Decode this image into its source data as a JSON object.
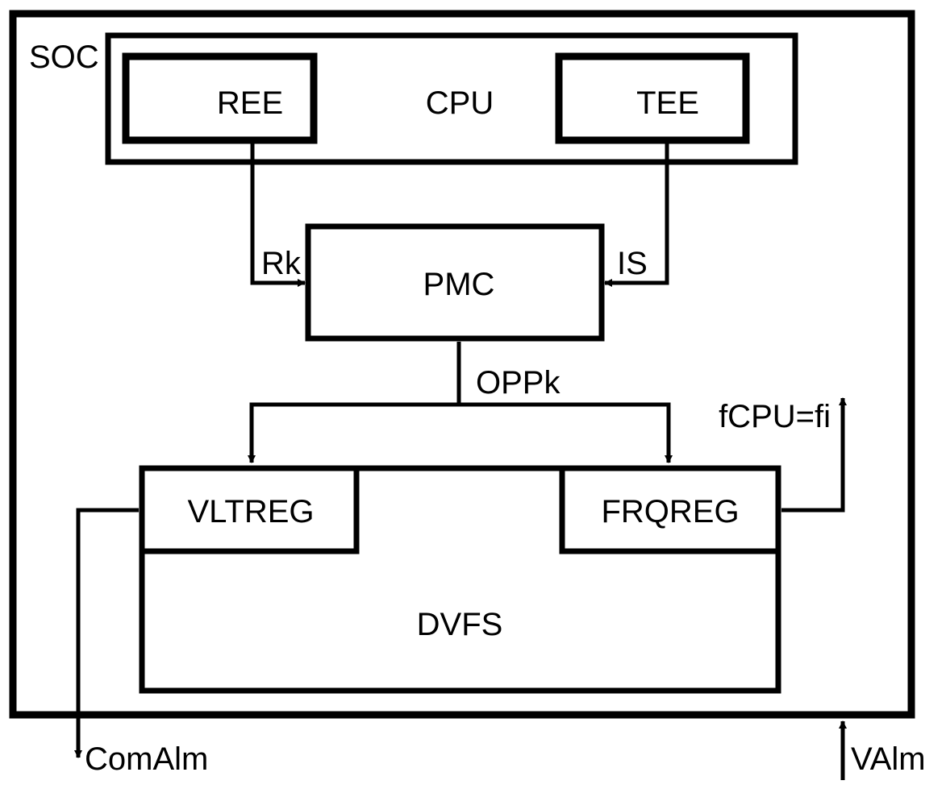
{
  "diagram": {
    "type": "block-diagram",
    "colors": {
      "stroke": "#000000",
      "background": "#ffffff"
    },
    "blocks": {
      "soc": {
        "label": "SOC"
      },
      "cpu": {
        "label": "CPU"
      },
      "ree": {
        "label": "REE"
      },
      "tee": {
        "label": "TEE"
      },
      "pmc": {
        "label": "PMC"
      },
      "dvfs": {
        "label": "DVFS"
      },
      "vltreg": {
        "label": "VLTREG"
      },
      "frqreg": {
        "label": "FRQREG"
      }
    },
    "signals": {
      "rk": {
        "label": "Rk",
        "from": "REE",
        "to": "PMC"
      },
      "is": {
        "label": "IS",
        "from": "TEE",
        "to": "PMC"
      },
      "oppk": {
        "label": "OPPk",
        "from": "PMC",
        "to": [
          "VLTREG",
          "FRQREG"
        ]
      },
      "fcpu": {
        "label": "fCPU=fi",
        "from": "FRQREG",
        "to": "output"
      },
      "comalm": {
        "label": "ComAlm",
        "from": "VLTREG",
        "to": "output"
      },
      "valm": {
        "label": "VAlm",
        "from": "input",
        "to": "SOC"
      }
    }
  }
}
